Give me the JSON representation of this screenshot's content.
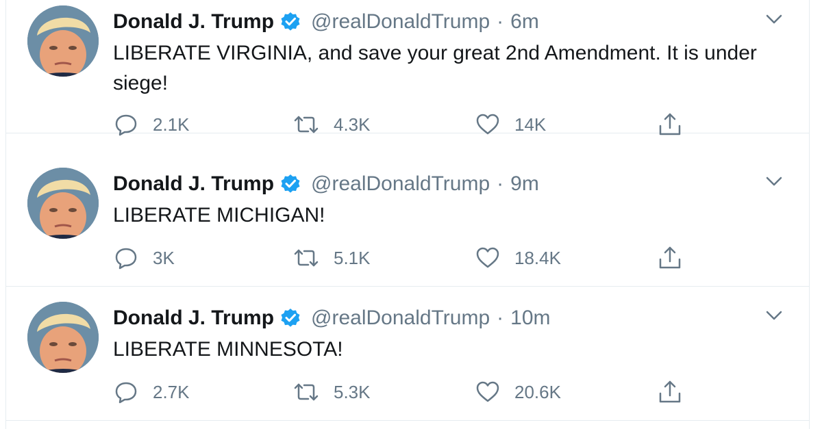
{
  "tweets": [
    {
      "author_name": "Donald J. Trump",
      "handle": "@realDonaldTrump",
      "separator": "·",
      "time": "6m",
      "text": "LIBERATE VIRGINIA, and save your great 2nd Amendment. It is under siege!",
      "replies": "2.1K",
      "retweets": "4.3K",
      "likes": "14K"
    },
    {
      "author_name": "Donald J. Trump",
      "handle": "@realDonaldTrump",
      "separator": "·",
      "time": "9m",
      "text": "LIBERATE MICHIGAN!",
      "replies": "3K",
      "retweets": "5.1K",
      "likes": "18.4K"
    },
    {
      "author_name": "Donald J. Trump",
      "handle": "@realDonaldTrump",
      "separator": "·",
      "time": "10m",
      "text": "LIBERATE MINNESOTA!",
      "replies": "2.7K",
      "retweets": "5.3K",
      "likes": "20.6K"
    }
  ],
  "icons": {
    "verified": "verified-badge-icon",
    "caret": "chevron-down-icon",
    "reply": "reply-icon",
    "retweet": "retweet-icon",
    "like": "heart-icon",
    "share": "share-icon"
  },
  "colors": {
    "verified_blue": "#1da1f2",
    "secondary_text": "#657786",
    "primary_text": "#14171a",
    "divider": "#e6ecf0"
  }
}
